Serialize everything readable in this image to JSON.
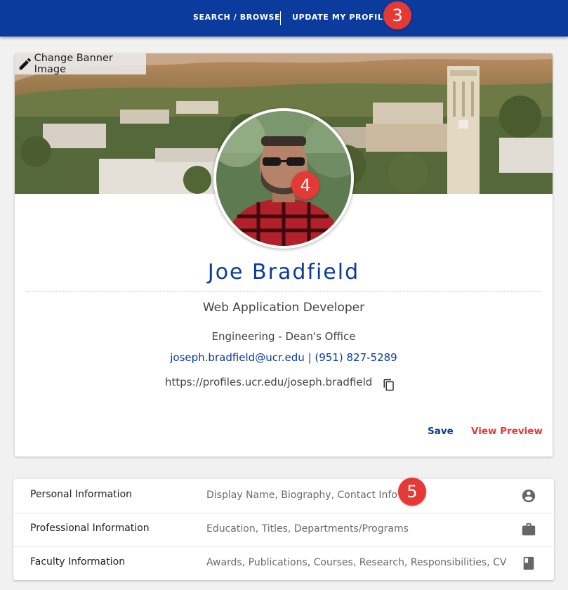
{
  "nav": {
    "search_browse": "SEARCH / BROWSE",
    "update_profile": "UPDATE MY PROFILE"
  },
  "callouts": {
    "c3": "3",
    "c4": "4",
    "c5": "5"
  },
  "banner": {
    "change_label": "Change Banner Image",
    "icon": "pencil-icon"
  },
  "profile": {
    "name": "Joe Bradfield",
    "title": "Web Application Developer",
    "department": "Engineering - Dean's Office",
    "email": "joseph.bradfield@ucr.edu",
    "separator": "|",
    "phone": "(951) 827-5289",
    "url": "https://profiles.ucr.edu/joseph.bradfield",
    "copy_icon": "copy-icon"
  },
  "actions": {
    "save": "Save",
    "view_preview": "View Preview"
  },
  "sections": [
    {
      "label": "Personal Information",
      "desc": "Display Name, Biography, Contact Info",
      "icon": "account-circle-icon"
    },
    {
      "label": "Professional Information",
      "desc": "Education, Titles, Departments/Programs",
      "icon": "briefcase-icon"
    },
    {
      "label": "Faculty Information",
      "desc": "Awards, Publications, Courses, Research, Responsibilities, CV",
      "icon": "book-icon"
    }
  ],
  "colors": {
    "brand_blue": "#0b3b9d",
    "callout_red": "#e53935",
    "preview_red": "#e53935"
  }
}
